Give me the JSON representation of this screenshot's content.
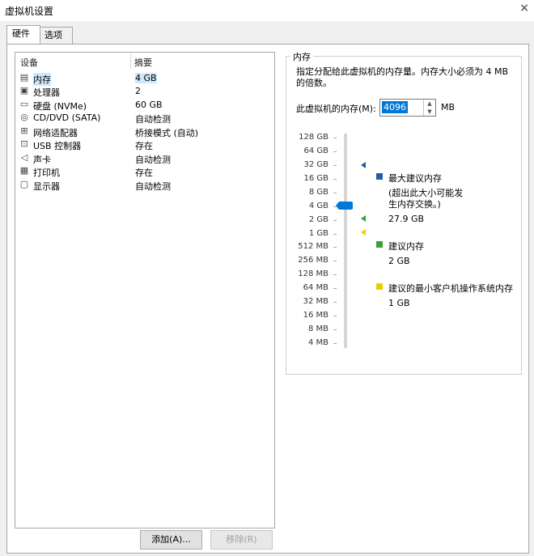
{
  "window": {
    "title": "虚拟机设置",
    "close_label": "×"
  },
  "tabs": [
    {
      "label": "硬件",
      "active": true
    },
    {
      "label": "选项",
      "active": false
    }
  ],
  "device_list": {
    "headers": [
      "设备",
      "摘要"
    ],
    "rows": [
      {
        "icon": "memory-icon",
        "name": "内存",
        "summary": "4 GB",
        "selected": true
      },
      {
        "icon": "processor-icon",
        "name": "处理器",
        "summary": "2"
      },
      {
        "icon": "harddisk-icon",
        "name": "硬盘 (NVMe)",
        "summary": "60 GB"
      },
      {
        "icon": "cd-dvd-icon",
        "name": "CD/DVD (SATA)",
        "summary": "自动检测"
      },
      {
        "icon": "network-adapter-icon",
        "name": "网络适配器",
        "summary": "桥接模式 (自动)"
      },
      {
        "icon": "usb-controller-icon",
        "name": "USB 控制器",
        "summary": "存在"
      },
      {
        "icon": "sound-card-icon",
        "name": "声卡",
        "summary": "自动检测"
      },
      {
        "icon": "printer-icon",
        "name": "打印机",
        "summary": "存在"
      },
      {
        "icon": "display-icon",
        "name": "显示器",
        "summary": "自动检测"
      }
    ]
  },
  "buttons": {
    "add": "添加(A)...",
    "remove": "移除(R)"
  },
  "memory": {
    "group_title": "内存",
    "description": "指定分配给此虚拟机的内存量。内存大小必须为 4 MB 的倍数。",
    "field_label": "此虚拟机的内存(M):",
    "value": "4096",
    "unit": "MB",
    "scale_labels": [
      "128 GB",
      "64 GB",
      "32 GB",
      "16 GB",
      "8 GB",
      "4 GB",
      "2 GB",
      "1 GB",
      "512 MB",
      "256 MB",
      "128 MB",
      "64 MB",
      "32 MB",
      "16 MB",
      "8 MB",
      "4 MB"
    ],
    "legend": {
      "max_label": "最大建议内存",
      "max_note": "(超出此大小可能发生内存交换。)",
      "max_value": "27.9 GB",
      "rec_label": "建议内存",
      "rec_value": "2 GB",
      "min_label": "建议的最小客户机操作系统内存",
      "min_value": "1 GB"
    },
    "colors": {
      "max": "#1f5ea8",
      "rec": "#3aa03a",
      "min": "#e8d000",
      "thumb": "#0078d7"
    }
  }
}
